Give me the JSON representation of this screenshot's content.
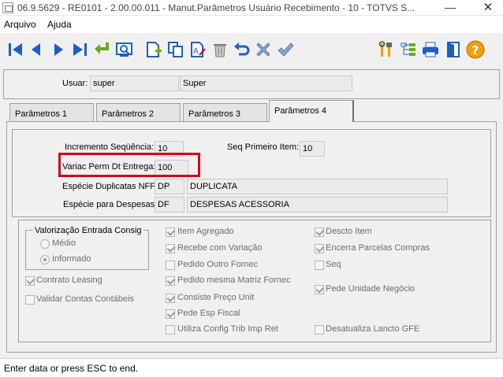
{
  "window": {
    "title": "06.9.5629 - RE0101 - 2.00.00.011 - Manut.Parâmetros Usuário Recebimento - 10 - TOTVS S...",
    "minimize": "—",
    "close": "✕"
  },
  "menu": {
    "items": [
      "Arquivo",
      "Ajuda"
    ]
  },
  "toolbar": {
    "buttons": [
      "first-record",
      "previous-record",
      "next-record",
      "last-record",
      "goto",
      "search",
      "new",
      "copy",
      "edit",
      "delete",
      "undo",
      "cancel",
      "save",
      "tools",
      "tree",
      "print",
      "exit",
      "help"
    ]
  },
  "user": {
    "label": "Usuar:",
    "code": "super",
    "name": "Super"
  },
  "tabs": [
    "Parâmetros 1",
    "Parâmetros 2",
    "Parâmetros 3",
    "Parâmetros 4"
  ],
  "active_tab": "Parâmetros 4",
  "params": {
    "incremento_label": "Incremento Seqüência:",
    "incremento_value": "10",
    "seq_primeiro_label": "Seq Primeiro Item:",
    "seq_primeiro_value": "10",
    "variac_label": "Variac Perm Dt Entrega:",
    "variac_value": "100",
    "dup_label": "Espécie Duplicatas NFF:",
    "dup_code": "DP",
    "dup_desc": "DUPLICATA",
    "desp_label": "Espécie para Despesas:",
    "desp_code": "DF",
    "desp_desc": "DESPESAS ACESSORIA"
  },
  "valorizacao": {
    "title": "Valorização Entrada Consig",
    "options": [
      "Médio",
      "Informado"
    ],
    "selected": "Informado"
  },
  "checkboxes": {
    "contrato_leasing": {
      "label": "Contrato Leasing",
      "checked": true
    },
    "validar_contas": {
      "label": "Validar Contas Contábeis",
      "checked": false
    },
    "item_agregado": {
      "label": "Item Agregado",
      "checked": true
    },
    "recebe_variacao": {
      "label": "Recebe com Variação",
      "checked": true
    },
    "pedido_outro": {
      "label": "Pedido Outro Fornec",
      "checked": false
    },
    "pedido_matriz": {
      "label": "Pedido mesma Matriz Fornec",
      "checked": true
    },
    "consiste_preco": {
      "label": "Consiste Preço Unit",
      "checked": true
    },
    "pede_esp_fiscal": {
      "label": "Pede Esp Fiscal",
      "checked": true
    },
    "utiliza_config": {
      "label": "Utiliza Config Trib Imp Ret",
      "checked": false
    },
    "descto_item": {
      "label": "Descto Item",
      "checked": true
    },
    "encerra_parcelas": {
      "label": "Encerra Parcelas Compras",
      "checked": true
    },
    "seq": {
      "label": "Seq",
      "checked": false
    },
    "pede_unidade": {
      "label": "Pede Unidade Negócio",
      "checked": true
    },
    "desatualiza_lancto": {
      "label": "Desatualiza Lancto GFE",
      "checked": false
    }
  },
  "status": {
    "text": "Enter data or press ESC to end."
  },
  "colors": {
    "highlight": "#d0021b",
    "nav_blue": "#1f5fbf",
    "help_orange": "#f0a000"
  }
}
